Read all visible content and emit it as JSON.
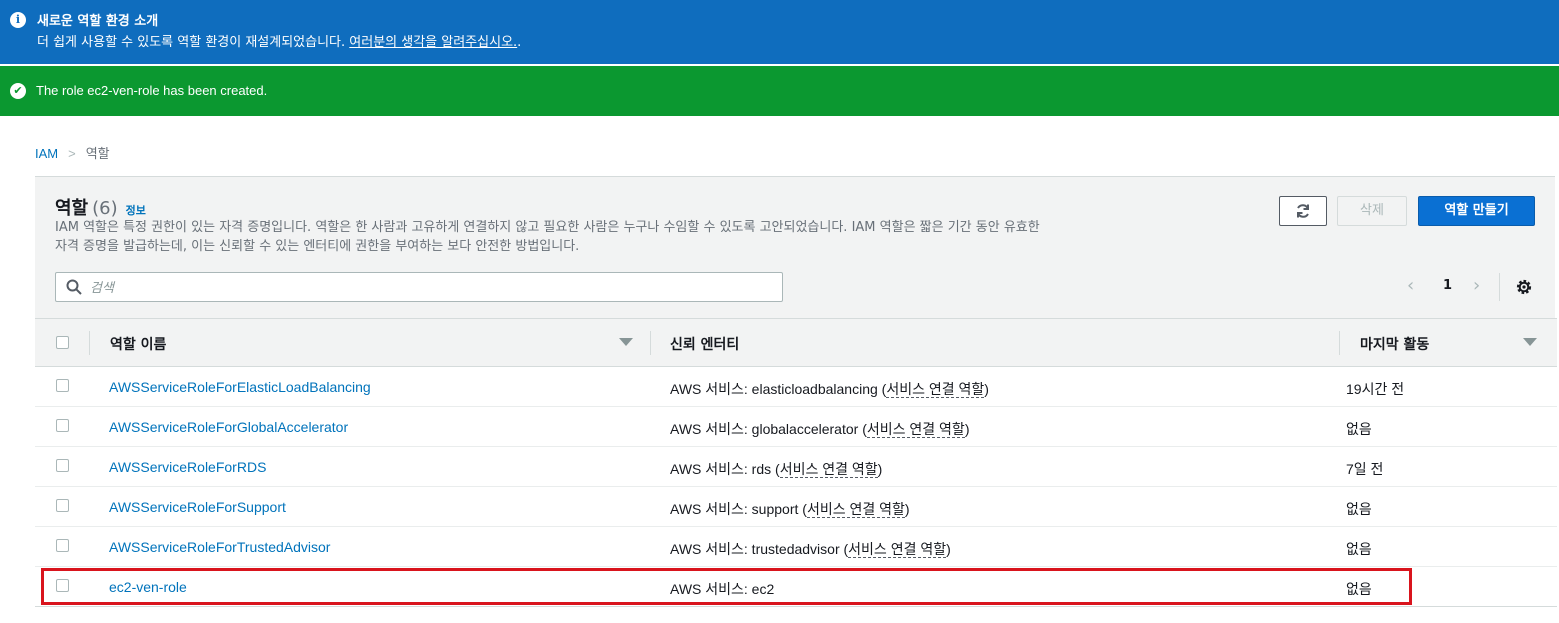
{
  "info_banner": {
    "icon": "info-icon",
    "title": "새로운 역할 환경 소개",
    "description": "더 쉽게 사용할 수 있도록 역할 환경이 재설계되었습니다. ",
    "feedback_link": "여러분의 생각을 알려주십시오.",
    "suffix": ".",
    "color": "#0f6dbe"
  },
  "success_banner": {
    "icon": "check-circle-icon",
    "message": "The role ec2-ven-role has been created.",
    "color": "#0b9830"
  },
  "breadcrumb": {
    "root": "IAM",
    "separator": ">",
    "current": "역할"
  },
  "panel": {
    "title": "역할",
    "count": "(6)",
    "info_link": "정보",
    "description": "IAM 역할은 특정 권한이 있는 자격 증명입니다. 역할은 한 사람과 고유하게 연결하지 않고 필요한 사람은 누구나 수임할 수 있도록 고안되었습니다. IAM 역할은 짧은 기간 동안 유효한 자격 증명을 발급하는데, 이는 신뢰할 수 있는 엔터티에 권한을 부여하는 보다 안전한 방법입니다.",
    "buttons": {
      "refresh_icon": "refresh-icon",
      "delete": "삭제",
      "create": "역할 만들기"
    },
    "search_placeholder": "검색",
    "pagination": {
      "prev": "‹",
      "page": "1",
      "next": "›"
    }
  },
  "table": {
    "columns": [
      "역할 이름",
      "신뢰 엔터티",
      "마지막 활동"
    ],
    "rows": [
      {
        "name": "AWSServiceRoleForElasticLoadBalancing",
        "trusted_prefix": "AWS 서비스: elasticloadbalancing (",
        "trusted_link": "서비스 연결 역할",
        "trusted_suffix": ")",
        "last_activity": "19시간 전"
      },
      {
        "name": "AWSServiceRoleForGlobalAccelerator",
        "trusted_prefix": "AWS 서비스: globalaccelerator (",
        "trusted_link": "서비스 연결 역할",
        "trusted_suffix": ")",
        "last_activity": "없음"
      },
      {
        "name": "AWSServiceRoleForRDS",
        "trusted_prefix": "AWS 서비스: rds (",
        "trusted_link": "서비스 연결 역할",
        "trusted_suffix": ")",
        "last_activity": "7일 전"
      },
      {
        "name": "AWSServiceRoleForSupport",
        "trusted_prefix": "AWS 서비스: support (",
        "trusted_link": "서비스 연결 역할",
        "trusted_suffix": ")",
        "last_activity": "없음"
      },
      {
        "name": "AWSServiceRoleForTrustedAdvisor",
        "trusted_prefix": "AWS 서비스: trustedadvisor (",
        "trusted_link": "서비스 연결 역할",
        "trusted_suffix": ")",
        "last_activity": "없음"
      },
      {
        "name": "ec2-ven-role",
        "trusted_prefix": "AWS 서비스: ec2",
        "trusted_link": "",
        "trusted_suffix": "",
        "last_activity": "없음",
        "highlighted": true
      }
    ]
  },
  "colors": {
    "link": "#0073bb",
    "primary_button": "#0a70d3",
    "highlight": "#d9141d"
  }
}
